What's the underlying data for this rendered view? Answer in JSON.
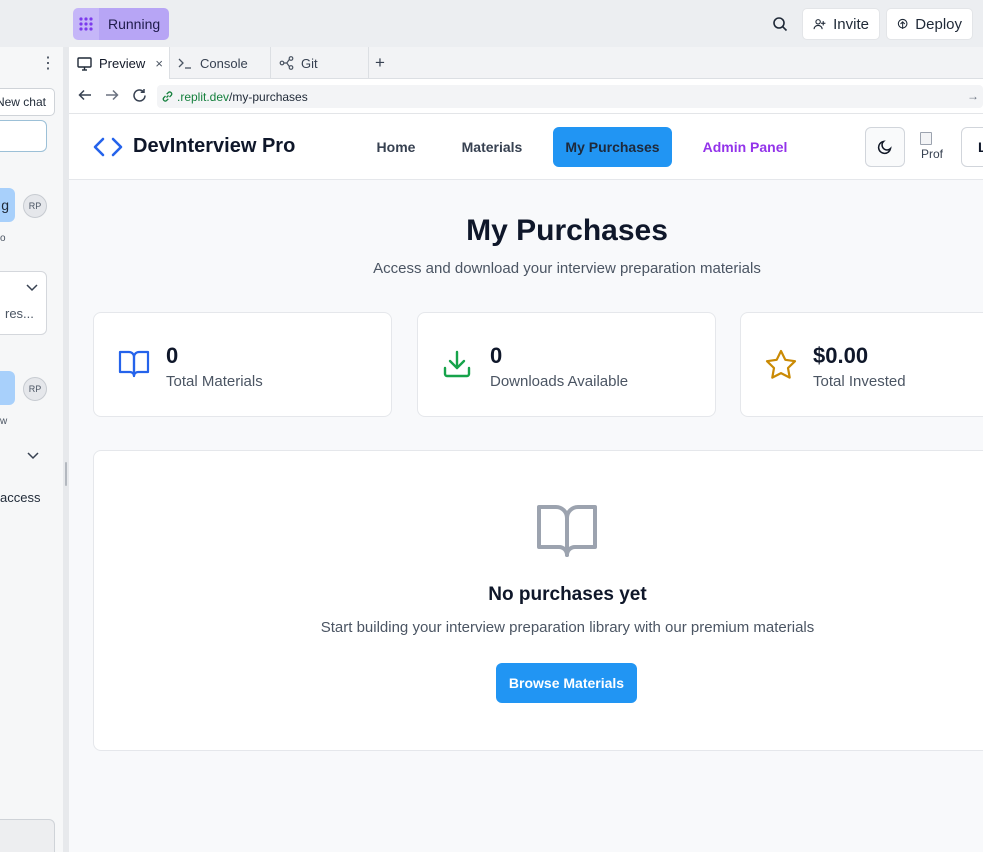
{
  "replit": {
    "status_label": "Running",
    "invite_label": "Invite",
    "deploy_label": "Deploy"
  },
  "chat_panel": {
    "new_chat_label": "New chat",
    "msg1_fragment": "g",
    "msg1_avatar": "RP",
    "msg1_caption": "o",
    "card_fragment": "res...",
    "msg2_avatar": "RP",
    "msg2_caption": "w",
    "access_fragment": "access"
  },
  "tabs": [
    {
      "label": "Preview",
      "icon": "monitor-icon"
    },
    {
      "label": "Console",
      "icon": "terminal-icon"
    },
    {
      "label": "Git",
      "icon": "git-icon"
    }
  ],
  "url": {
    "host": ".replit.dev",
    "path": "/my-purchases"
  },
  "app": {
    "brand": "DevInterview Pro",
    "nav": {
      "home": "Home",
      "materials": "Materials",
      "my_purchases": "My Purchases",
      "admin_panel": "Admin Panel"
    },
    "profile_alt": "Prof",
    "login_initial": "L"
  },
  "page": {
    "title": "My Purchases",
    "subtitle": "Access and download your interview preparation materials"
  },
  "stats": [
    {
      "value": "0",
      "label": "Total Materials",
      "icon": "book-open-icon",
      "color": "#2563eb"
    },
    {
      "value": "0",
      "label": "Downloads Available",
      "icon": "download-icon",
      "color": "#16a34a"
    },
    {
      "value": "$0.00",
      "label": "Total Invested",
      "icon": "star-icon",
      "color": "#ca8a04"
    }
  ],
  "empty_state": {
    "title": "No purchases yet",
    "text": "Start building your interview preparation library with our premium materials",
    "button": "Browse Materials"
  },
  "colors": {
    "accent": "#2195f3",
    "admin_link": "#9333ea",
    "running_badge": "#b7a5f5"
  }
}
